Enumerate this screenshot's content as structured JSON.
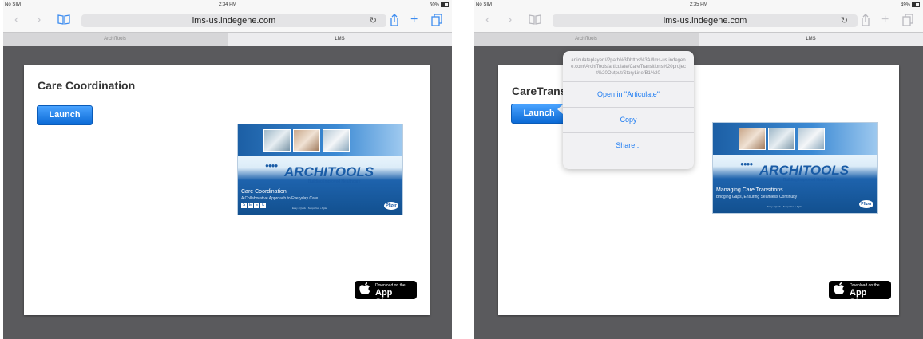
{
  "left": {
    "status": {
      "carrier": "No SIM",
      "time": "2:34 PM",
      "battery": "50%"
    },
    "url": "lms-us.indegene.com",
    "tabs": [
      "ArchiTools",
      "LMS"
    ],
    "course_title": "Care Coordination",
    "launch_label": "Launch",
    "thumbnail": {
      "brand": "ARCHITOOLS",
      "tagline": "Building Improved Healthcare",
      "subtitle": "Care Coordination",
      "subtitle2": "A Collaborative Approach to Everyday Care",
      "tiles": [
        "S",
        "E",
        "E",
        "C"
      ],
      "footer": "Easy • Quick • Supportive • Agile",
      "pfizer": "Pfizer"
    },
    "appstore": {
      "small": "Download on the",
      "big": "App Store"
    }
  },
  "right": {
    "status": {
      "carrier": "No SIM",
      "time": "2:35 PM",
      "battery": "49%"
    },
    "url": "lms-us.indegene.com",
    "tabs": [
      "ArchiTools",
      "LMS"
    ],
    "course_title": "CareTrans",
    "launch_label": "Launch",
    "popover": {
      "url": "articulateplayer://?path%3Dhttps%3A//lms-us.indegene.com/ArchiTools/articulate/CareTransitions%20project%20Output/StoryLine/B1%20",
      "items": [
        "Open in \"Articulate\"",
        "Copy",
        "Share..."
      ]
    },
    "thumbnail": {
      "brand": "ARCHITOOLS",
      "tagline": "Building Improved Healthcare",
      "subtitle": "Managing Care Transitions",
      "subtitle2": "Bridging Gaps, Ensuring Seamless Continuity",
      "footer": "Easy • Quick • Supportive • Agile",
      "pfizer": "Pfizer"
    },
    "appstore": {
      "small": "Download on the",
      "big": "App Store"
    }
  }
}
